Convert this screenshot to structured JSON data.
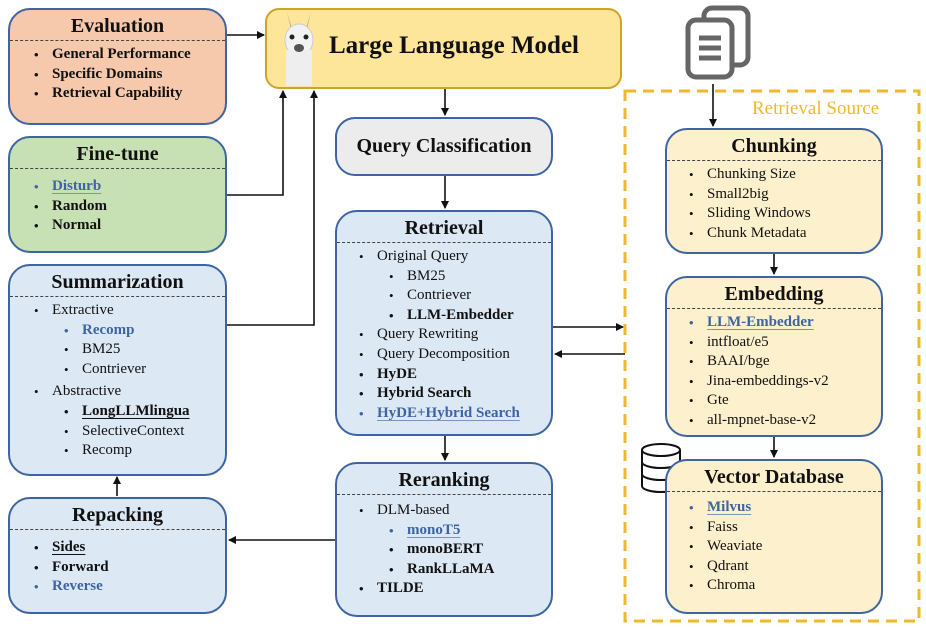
{
  "llm": {
    "title": "Large Language Model",
    "icon": "llama-icon"
  },
  "query_classification": {
    "title": "Query Classification"
  },
  "retrieval_source": {
    "label": "Retrieval Source",
    "icon": "documents-icon"
  },
  "evaluation": {
    "title": "Evaluation",
    "items": [
      "General Performance",
      "Specific Domains",
      "Retrieval Capability"
    ]
  },
  "finetune": {
    "title": "Fine-tune",
    "items": [
      "Disturb",
      "Random",
      "Normal"
    ]
  },
  "summarization": {
    "title": "Summarization",
    "items": [
      "Extractive",
      "Recomp",
      "BM25",
      "Contriever",
      "Abstractive",
      "LongLLMlingua",
      "SelectiveContext",
      "Recomp"
    ]
  },
  "repacking": {
    "title": "Repacking",
    "items": [
      "Sides",
      "Forward",
      "Reverse"
    ]
  },
  "retrieval": {
    "title": "Retrieval",
    "items": [
      "Original Query",
      "BM25",
      "Contriever",
      "LLM-Embedder",
      "Query Rewriting",
      "Query Decomposition",
      "HyDE",
      "Hybrid Search",
      "HyDE+Hybrid Search"
    ]
  },
  "reranking": {
    "title": "Reranking",
    "items": [
      "DLM-based",
      "monoT5",
      "monoBERT",
      "RankLLaMA",
      "TILDE"
    ]
  },
  "chunking": {
    "title": "Chunking",
    "items": [
      "Chunking Size",
      "Small2big",
      "Sliding Windows",
      "Chunk Metadata"
    ]
  },
  "embedding": {
    "title": "Embedding",
    "items": [
      "LLM-Embedder",
      "intfloat/e5",
      "BAAI/bge",
      "Jina-embeddings-v2",
      "Gte",
      "all-mpnet-base-v2"
    ]
  },
  "vector_db": {
    "title": "Vector Database",
    "icon": "database-icon",
    "items": [
      "Milvus",
      "Faiss",
      "Weaviate",
      "Qdrant",
      "Chroma"
    ]
  },
  "colors": {
    "box_border": "#3d64a3",
    "highlight_blue": "#3d64a3",
    "source_dash": "#f0b92b",
    "llm_fill": "#fde69a",
    "eval_fill": "#f6c9ad",
    "finetune_fill": "#c7e0b4",
    "module_fill": "#dde8f5",
    "source_fill": "#fdf0cc"
  }
}
